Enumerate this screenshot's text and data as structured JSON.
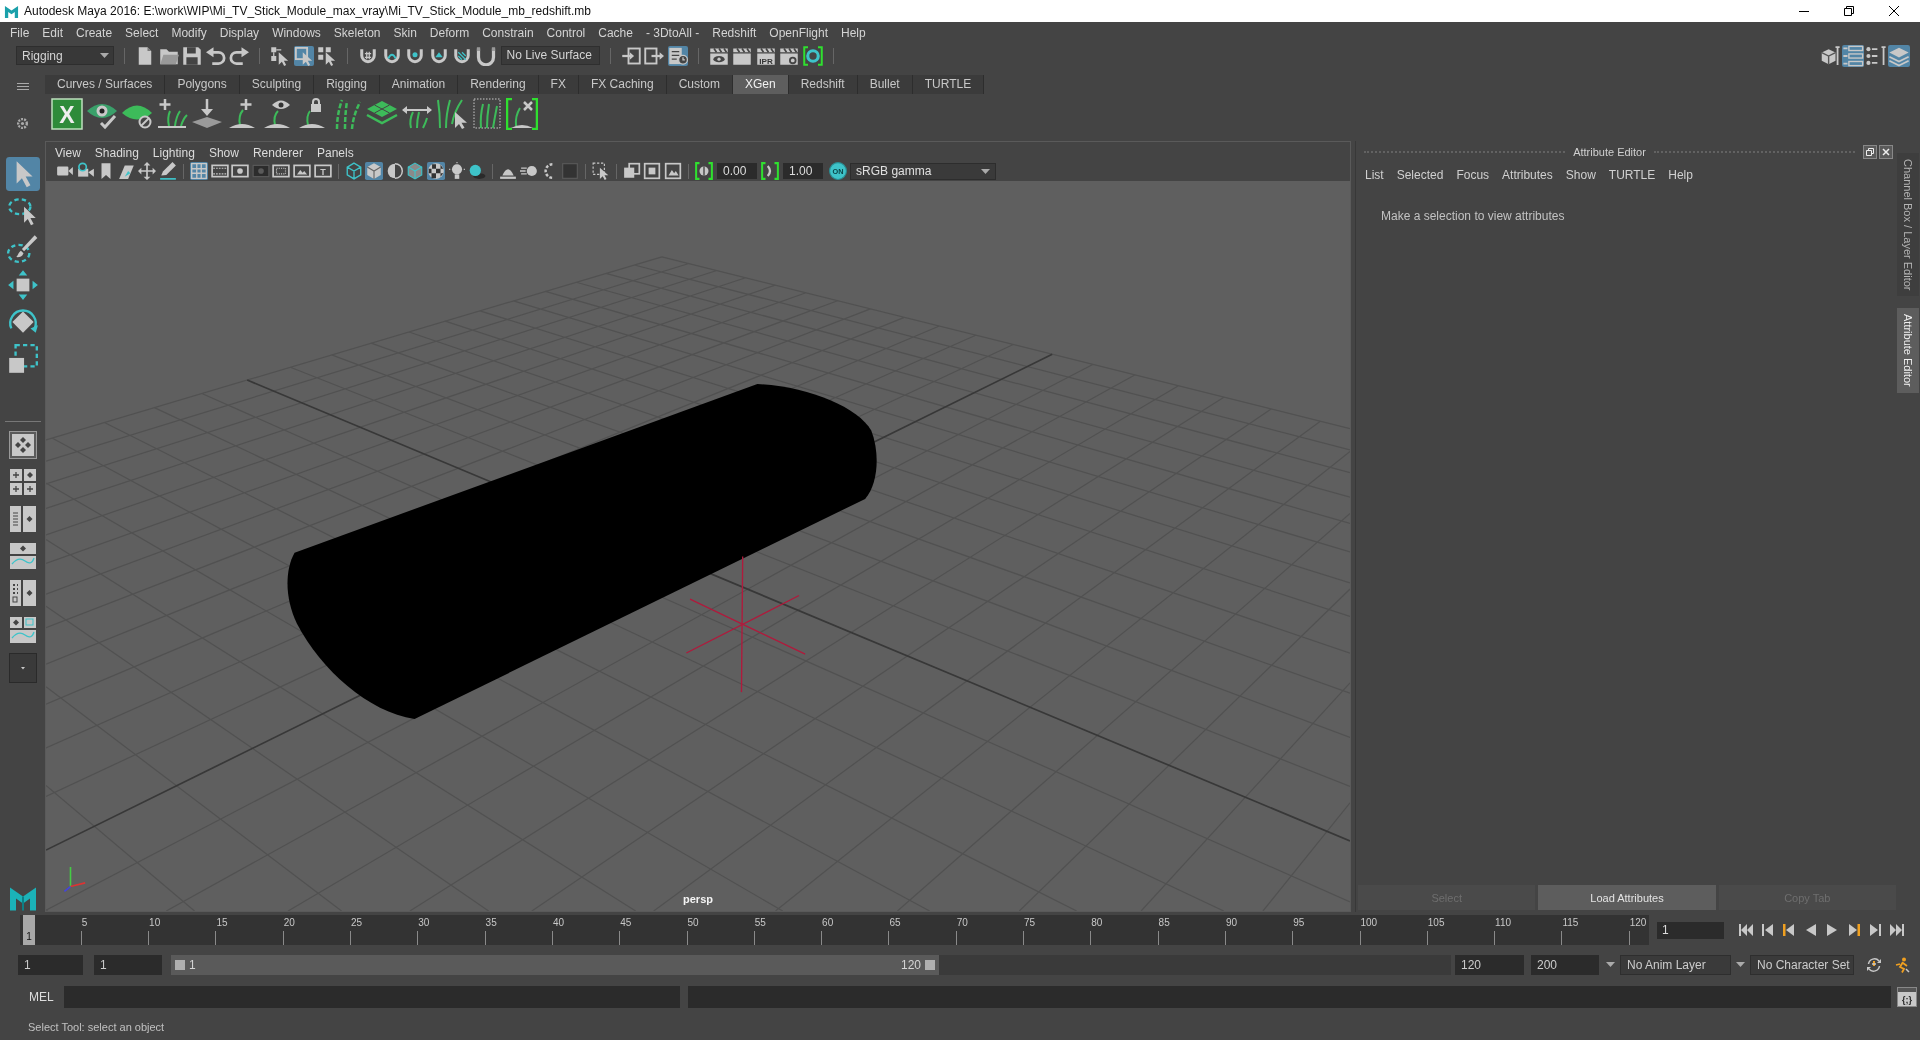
{
  "window": {
    "title": "Autodesk Maya 2016: E:\\work\\WIP\\Mi_TV_Stick_Module_max_vray\\Mi_TV_Stick_Module_mb_redshift.mb"
  },
  "menu_bar": [
    "File",
    "Edit",
    "Create",
    "Select",
    "Modify",
    "Display",
    "Windows",
    "Skeleton",
    "Skin",
    "Deform",
    "Constrain",
    "Control",
    "Cache",
    "- 3DtoAll -",
    "Redshift",
    "OpenFlight",
    "Help"
  ],
  "status_line": {
    "menu_set": "Rigging",
    "file_tools": [
      {
        "kind": "new"
      },
      {
        "kind": "open"
      },
      {
        "kind": "save"
      },
      {
        "kind": "undo"
      },
      {
        "kind": "redo"
      }
    ],
    "selection_modes": [
      {
        "kind": "hierarchy",
        "selected": false
      },
      {
        "kind": "object",
        "selected": true
      },
      {
        "kind": "component",
        "selected": false
      }
    ],
    "snap_tools": [
      {
        "kind": "snapgrid"
      },
      {
        "kind": "snapcurve"
      },
      {
        "kind": "snappoint"
      },
      {
        "kind": "snapplane"
      },
      {
        "kind": "snapsurface"
      },
      {
        "kind": "makelive"
      }
    ],
    "live_surface": "No Live Surface",
    "history_tools": [
      {
        "kind": "inputs",
        "on": false
      },
      {
        "kind": "outputs",
        "on": false
      },
      {
        "kind": "history",
        "on": true
      }
    ],
    "render_tools": [
      {
        "kind": "render"
      },
      {
        "kind": "sequence"
      },
      {
        "kind": "ipr",
        "label": "IPR"
      },
      {
        "kind": "rendersettings"
      },
      {
        "kind": "hypershade"
      }
    ],
    "panel_toggles": [
      {
        "kind": "toolkit",
        "on": false
      },
      {
        "kind": "attributes",
        "on": true
      },
      {
        "kind": "toolsettings",
        "on": false
      },
      {
        "kind": "channels",
        "on": true
      }
    ]
  },
  "shelf": {
    "tabs": [
      {
        "label": "Curves / Surfaces",
        "selected": false
      },
      {
        "label": "Polygons",
        "selected": false
      },
      {
        "label": "Sculpting",
        "selected": false
      },
      {
        "label": "Rigging",
        "selected": false
      },
      {
        "label": "Animation",
        "selected": false
      },
      {
        "label": "Rendering",
        "selected": false
      },
      {
        "label": "FX",
        "selected": false
      },
      {
        "label": "FX Caching",
        "selected": false
      },
      {
        "label": "Custom",
        "selected": false
      },
      {
        "label": "XGen",
        "selected": true
      },
      {
        "label": "Redshift",
        "selected": false
      },
      {
        "label": "Bullet",
        "selected": false
      },
      {
        "label": "TURTLE",
        "selected": false
      }
    ],
    "tools": [
      {
        "kind": "xgen",
        "label": "X"
      },
      {
        "kind": "eyecheck"
      },
      {
        "kind": "leafblock"
      },
      {
        "kind": "plusstrands"
      },
      {
        "kind": "arrowplane"
      },
      {
        "kind": "plusarc"
      },
      {
        "kind": "eyearc"
      },
      {
        "kind": "lockarc"
      },
      {
        "kind": "strands"
      },
      {
        "kind": "layers"
      },
      {
        "kind": "arrowstrands"
      },
      {
        "kind": "strandscursor"
      },
      {
        "kind": "dottedstrands"
      },
      {
        "kind": "bracketx"
      }
    ]
  },
  "toolbox": {
    "tools": [
      {
        "kind": "select",
        "selected": true
      },
      {
        "kind": "lasso",
        "selected": false
      },
      {
        "kind": "paint",
        "selected": false
      },
      {
        "kind": "move",
        "selected": false
      },
      {
        "kind": "rotate",
        "selected": false
      },
      {
        "kind": "scale",
        "selected": false
      }
    ]
  },
  "viewport": {
    "menu": [
      "View",
      "Shading",
      "Lighting",
      "Show",
      "Renderer",
      "Panels"
    ],
    "toolbar": {
      "groups": [
        {
          "tools": [
            {
              "kind": "camera",
              "on": false
            },
            {
              "kind": "camattr",
              "on": false
            },
            {
              "kind": "bookmark",
              "on": false
            },
            {
              "kind": "imageplane",
              "on": false
            },
            {
              "kind": "panzoom",
              "on": false
            },
            {
              "kind": "pencil",
              "on": false
            }
          ]
        },
        {
          "tools": [
            {
              "kind": "grid",
              "on": true
            },
            {
              "kind": "filmgate",
              "on": false
            },
            {
              "kind": "resgate",
              "on": false
            },
            {
              "kind": "gatemask",
              "on": false
            },
            {
              "kind": "fieldchart",
              "on": false
            },
            {
              "kind": "safeaction",
              "on": false
            },
            {
              "kind": "safetitle",
              "label": "T",
              "on": false
            }
          ]
        },
        {
          "tools": [
            {
              "kind": "wireframe",
              "on": false
            },
            {
              "kind": "smooth",
              "on": true
            },
            {
              "kind": "material",
              "on": false
            },
            {
              "kind": "wireshaded",
              "on": false
            },
            {
              "kind": "textured",
              "on": true
            },
            {
              "kind": "lights",
              "on": false
            },
            {
              "kind": "shadows",
              "on": false
            }
          ]
        },
        {
          "tools": [
            {
              "kind": "ao",
              "on": false
            },
            {
              "kind": "motionblur",
              "on": false
            },
            {
              "kind": "antialias",
              "on": false
            },
            {
              "kind": "dof",
              "on": false
            }
          ]
        },
        {
          "tools": [
            {
              "kind": "isolate",
              "on": false
            }
          ]
        },
        {
          "tools": [
            {
              "kind": "xray",
              "on": false
            },
            {
              "kind": "xraycomp",
              "on": false
            },
            {
              "kind": "xrayjoint",
              "on": false
            }
          ]
        }
      ],
      "exposure": "0.00",
      "gamma": "1.00",
      "color_management": {
        "label": "ON",
        "on": true
      },
      "view_transform": "sRGB gamma"
    },
    "camera": "persp"
  },
  "attribute_editor": {
    "title": "Attribute Editor",
    "menu": [
      "List",
      "Selected",
      "Focus",
      "Attributes",
      "Show",
      "TURTLE",
      "Help"
    ],
    "message": "Make a selection to view attributes",
    "buttons": [
      {
        "label": "Select",
        "disabled": true
      },
      {
        "label": "Load Attributes",
        "disabled": false
      },
      {
        "label": "Copy Tab",
        "disabled": true
      }
    ]
  },
  "side_tabs": [
    {
      "label": "Channel Box / Layer Editor",
      "selected": false
    },
    {
      "label": "Attribute Editor",
      "selected": true
    }
  ],
  "time_slider": {
    "current_frame": "1",
    "level": 0,
    "ticks": [
      "5",
      "10",
      "15",
      "20",
      "25",
      "30",
      "35",
      "40",
      "45",
      "50",
      "55",
      "60",
      "65",
      "70",
      "75",
      "80",
      "85",
      "90",
      "95",
      "100",
      "105",
      "110",
      "115",
      "120"
    ],
    "frame_field": "1"
  },
  "range_slider": {
    "start_time": "1",
    "range_start": "1",
    "range_start_label": "1",
    "range_end_label": "120",
    "level": 0.6,
    "range_end": "120",
    "end_time": "200",
    "anim_layer": "No Anim Layer",
    "character_set": "No Character Set"
  },
  "command_line": {
    "language": "MEL",
    "script_editor": "{;}"
  },
  "help_line": "Select Tool: select an object"
}
